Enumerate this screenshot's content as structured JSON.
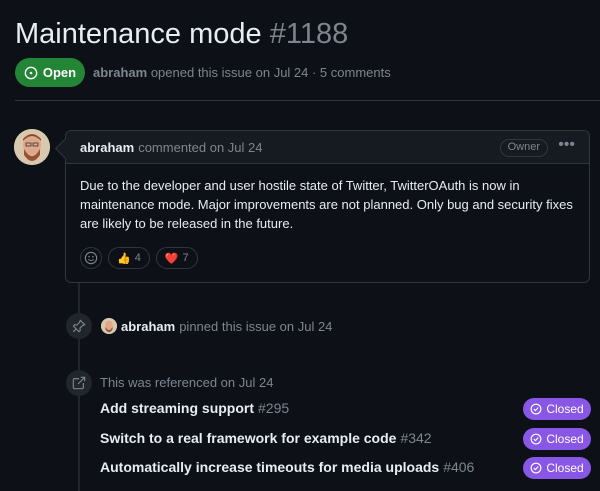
{
  "issue": {
    "title": "Maintenance mode",
    "number": "#1188",
    "status": "Open",
    "author": "abraham",
    "meta_text": "opened this issue on Jul 24 · 5 comments"
  },
  "comment": {
    "author": "abraham",
    "when": "commented on Jul 24",
    "role": "Owner",
    "body": "Due to the developer and user hostile state of Twitter, TwitterOAuth is now in maintenance mode. Major improvements are not planned. Only bug and security fixes are likely to be released in the future.",
    "reactions": [
      {
        "emoji": "👍",
        "count": "4"
      },
      {
        "emoji": "❤️",
        "count": "7"
      }
    ]
  },
  "pin_event": {
    "actor": "abraham",
    "text": "pinned this issue on Jul 24"
  },
  "reference_event": {
    "text": "This was referenced on Jul 24"
  },
  "references": [
    {
      "name": "Add streaming support",
      "number": "#295",
      "status": "Closed"
    },
    {
      "name": "Switch to a real framework for example code",
      "number": "#342",
      "status": "Closed"
    },
    {
      "name": "Automatically increase timeouts for media uploads",
      "number": "#406",
      "status": "Closed"
    }
  ],
  "colors": {
    "background": "#0d1117",
    "open_green": "#238636",
    "closed_purple": "#8957e5",
    "muted": "#7d8590",
    "border": "#30363d"
  }
}
